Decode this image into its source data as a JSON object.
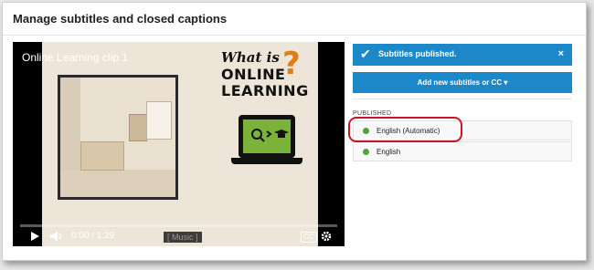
{
  "page": {
    "title": "Manage subtitles and closed captions"
  },
  "player": {
    "video_title": "Online Learning clip 1",
    "promo_line1": "What is",
    "promo_line2": "ONLINE",
    "promo_line3": "LEARNING",
    "promo_qmark": "?",
    "time": "0:00 / 1:29",
    "caption": "[ Music ]",
    "cc_label": "CC",
    "icons": [
      "play-icon",
      "volume-icon",
      "cc-icon",
      "settings-icon"
    ]
  },
  "panel": {
    "banner_text": "Subtitles published.",
    "banner_close": "×",
    "add_button": "Add new subtitles or CC ▾",
    "section_label": "PUBLISHED",
    "tracks": [
      {
        "label": "English (Automatic)",
        "status_color": "#4fa33a"
      },
      {
        "label": "English",
        "status_color": "#4fa33a"
      }
    ]
  },
  "colors": {
    "accent": "#1c87c9",
    "highlight": "#c8152a"
  }
}
